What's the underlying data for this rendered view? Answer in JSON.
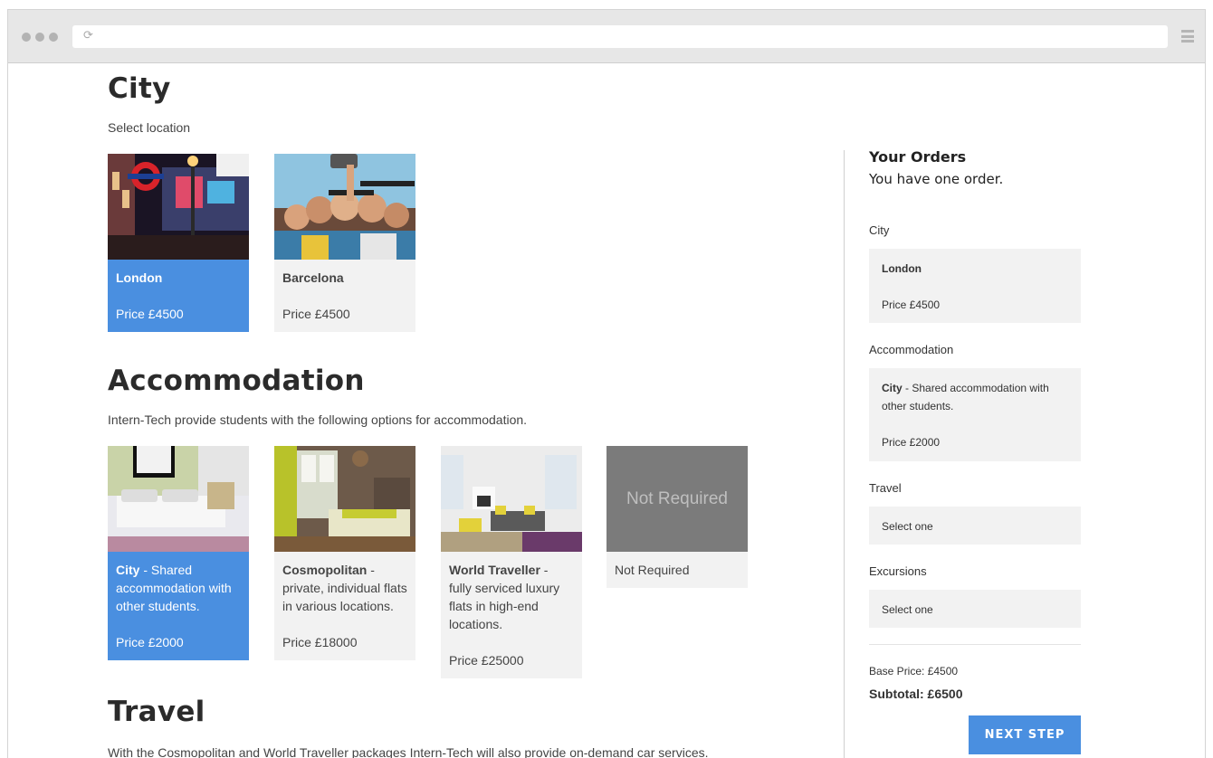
{
  "city": {
    "title": "City",
    "description": "Select location",
    "options": [
      {
        "name": "London",
        "price": "Price £4500",
        "selected": true
      },
      {
        "name": "Barcelona",
        "price": "Price £4500",
        "selected": false
      }
    ]
  },
  "accommodation": {
    "title": "Accommodation",
    "description": "Intern-Tech provide students with the following options for accommodation.",
    "options": [
      {
        "name": "City",
        "detail": " - Shared accommodation with other students.",
        "price": "Price £2000",
        "selected": true
      },
      {
        "name": "Cosmopolitan",
        "detail": " - private, individual flats in various locations.",
        "price": "Price £18000",
        "selected": false
      },
      {
        "name": "World Traveller",
        "detail": " - fully serviced luxury flats in high-end locations.",
        "price": "Price £25000",
        "selected": false
      },
      {
        "name": "Not Required",
        "detail": "",
        "price": "",
        "image_text": "Not Required",
        "selected": false
      }
    ]
  },
  "travel": {
    "title": "Travel",
    "description": "With the Cosmopolitan and World Traveller packages Intern-Tech will also provide on-demand car services. Intern"
  },
  "orders": {
    "title": "Your Orders",
    "subtitle": "You have one order.",
    "city_label": "City",
    "city_name": "London",
    "city_price": "Price £4500",
    "accommodation_label": "Accommodation",
    "accommodation_name": "City",
    "accommodation_detail": " - Shared accommodation with other students.",
    "accommodation_price": "Price £2000",
    "travel_label": "Travel",
    "travel_value": "Select one",
    "excursions_label": "Excursions",
    "excursions_value": "Select one",
    "base_price": "Base Price: £4500",
    "subtotal": "Subtotal: £6500",
    "next_label": "NEXT STEP"
  },
  "colors": {
    "accent": "#4a8fe0",
    "card_bg": "#f2f2f2",
    "not_required_bg": "#7b7b7b"
  }
}
